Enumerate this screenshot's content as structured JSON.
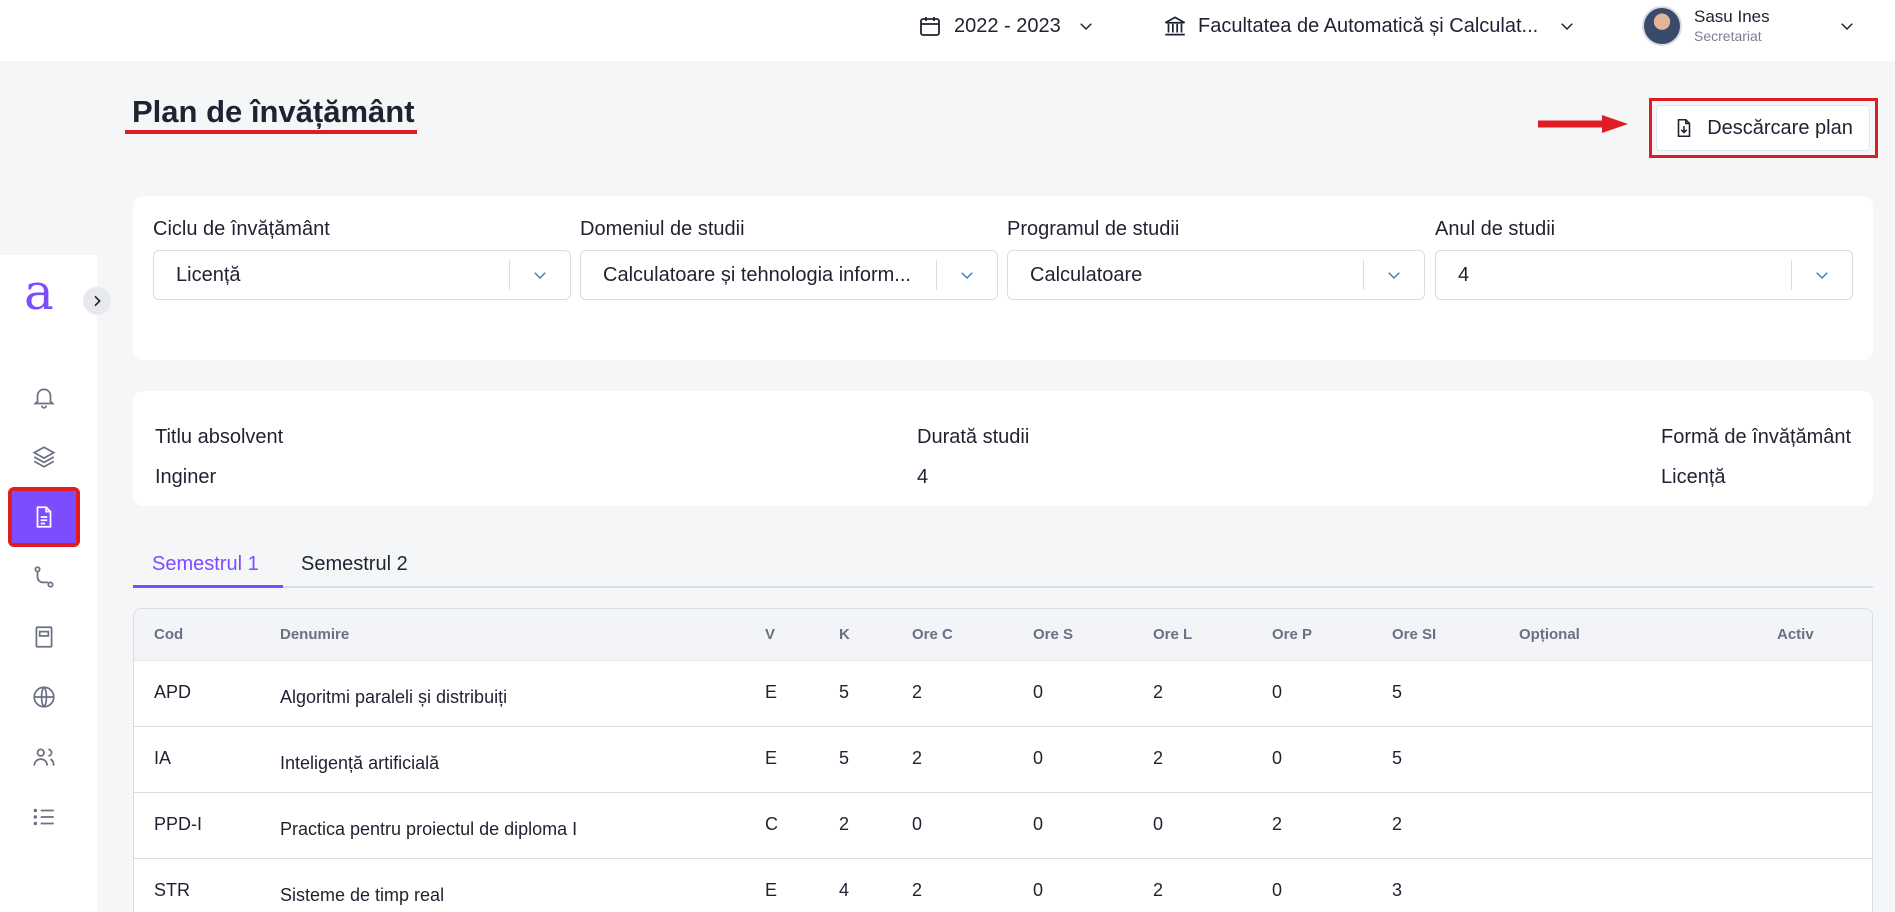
{
  "topbar": {
    "academic_year": "2022 - 2023",
    "faculty": "Facultatea de Automatică și Calculat...",
    "user": {
      "name": "Sasu Ines",
      "role": "Secretariat"
    }
  },
  "sidebar": {
    "logo": "a",
    "items": [
      {
        "icon": "bell-icon"
      },
      {
        "icon": "layers-icon"
      },
      {
        "icon": "document-icon",
        "active": true
      },
      {
        "icon": "route-icon"
      },
      {
        "icon": "notebook-icon"
      },
      {
        "icon": "globe-icon"
      },
      {
        "icon": "users-icon"
      },
      {
        "icon": "list-icon"
      }
    ]
  },
  "page": {
    "title": "Plan de învățământ",
    "download_label": "Descărcare plan"
  },
  "filters": [
    {
      "label": "Ciclu de învățământ",
      "value": "Licență"
    },
    {
      "label": "Domeniul de studii",
      "value": "Calculatoare și tehnologia inform..."
    },
    {
      "label": "Programul de studii",
      "value": "Calculatoare"
    },
    {
      "label": "Anul de studii",
      "value": "4"
    }
  ],
  "info": [
    {
      "label": "Titlu absolvent",
      "value": "Inginer"
    },
    {
      "label": "Durată studii",
      "value": "4"
    },
    {
      "label": "Formă de învățământ",
      "value": "Licență"
    }
  ],
  "tabs": [
    "Semestrul 1",
    "Semestrul 2"
  ],
  "table": {
    "headers": [
      "Cod",
      "Denumire",
      "V",
      "K",
      "Ore C",
      "Ore S",
      "Ore L",
      "Ore P",
      "Ore SI",
      "Opțional",
      "Activ"
    ],
    "rows": [
      [
        "APD",
        "Algoritmi paraleli și distribuiți",
        "E",
        "5",
        "2",
        "0",
        "2",
        "0",
        "5",
        "",
        ""
      ],
      [
        "IA",
        "Inteligență artificială",
        "E",
        "5",
        "2",
        "0",
        "2",
        "0",
        "5",
        "",
        ""
      ],
      [
        "PPD-I",
        "Practica pentru proiectul de diploma I",
        "C",
        "2",
        "0",
        "0",
        "0",
        "2",
        "2",
        "",
        ""
      ],
      [
        "STR",
        "Sisteme de timp real",
        "E",
        "4",
        "2",
        "0",
        "2",
        "0",
        "3",
        "",
        ""
      ]
    ]
  },
  "colors": {
    "accent": "#7c4dff",
    "annotation": "#e11d24"
  }
}
